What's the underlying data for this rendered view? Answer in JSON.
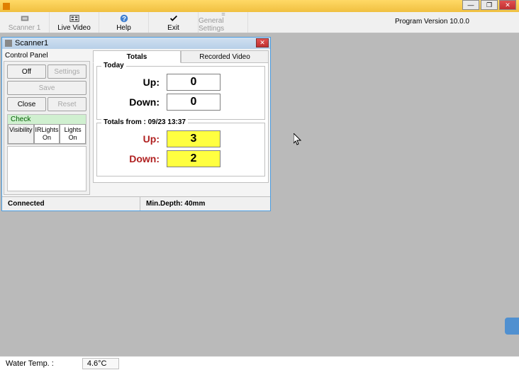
{
  "version_label": "Program Version 10.0.0",
  "toolbar": {
    "scanner1": "Scanner 1",
    "live_video": "Live Video",
    "help": "Help",
    "exit": "Exit",
    "general_settings": "General Settings"
  },
  "scanner_window": {
    "title": "Scanner1",
    "control_panel_title": "Control Panel",
    "buttons": {
      "off": "Off",
      "settings": "Settings",
      "save": "Save",
      "close": "Close",
      "reset": "Reset"
    },
    "check": {
      "legend": "Check",
      "visibility": "Visibility",
      "irlights": "IRLights\nOn",
      "lights": "Lights\nOn"
    },
    "tabs": {
      "totals": "Totals",
      "recorded_video": "Recorded Video"
    },
    "today": {
      "label": "Today",
      "up_label": "Up:",
      "up_value": "0",
      "down_label": "Down:",
      "down_value": "0"
    },
    "totals_from": {
      "label": "Totals from : 09/23 13:37",
      "up_label": "Up:",
      "up_value": "3",
      "down_label": "Down:",
      "down_value": "2"
    },
    "status": {
      "connected": "Connected",
      "min_depth": "Min.Depth:  40mm"
    }
  },
  "bottom": {
    "water_temp_label": "Water Temp. :",
    "water_temp_value": "4.6°C"
  }
}
